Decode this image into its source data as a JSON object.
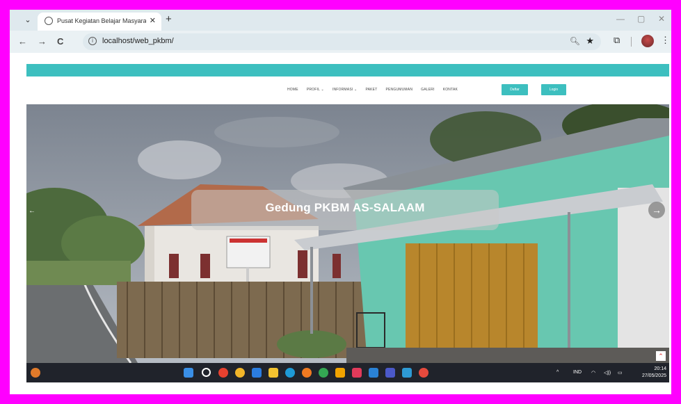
{
  "browser": {
    "tab_title": "Pusat Kegiatan Belajar Masyara",
    "tab_close": "✕",
    "new_tab": "+",
    "url": "localhost/web_pkbm/",
    "back": "←",
    "forward": "→",
    "reload": "C",
    "window_min": "—",
    "window_restore": "▢",
    "window_close": "✕"
  },
  "site": {
    "menu": [
      "HOME",
      "PROFIL ⌄",
      "INFORMASI ⌄",
      "PAKET",
      "PENGUMUMAN",
      "GALERI",
      "KONTAK"
    ],
    "daftar_label": "Daftar",
    "login_label": "Login",
    "hero_caption": "Gedung PKBM AS-SALAAM",
    "next_arrow": "→",
    "prev_arrow": "←"
  },
  "taskbar": {
    "lang": "IND",
    "time": "20:14",
    "date": "27/05/2025",
    "caret": "^"
  },
  "colors": {
    "accent": "#3dbfbf",
    "border": "#ff00ff"
  }
}
